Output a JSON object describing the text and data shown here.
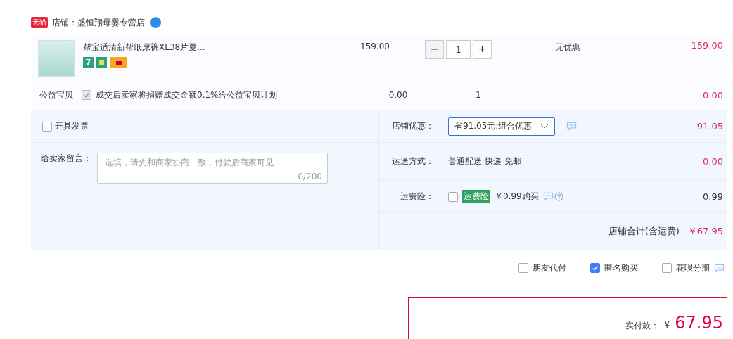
{
  "store": {
    "badge": "天猫",
    "label": "店铺：盛恒翔母婴专营店"
  },
  "item": {
    "title": "帮宝适清新帮纸尿裤XL38片夏...",
    "return_badge": "7",
    "price": "159.00",
    "minus": "−",
    "minus_disabled": true,
    "quantity": "1",
    "plus": "+",
    "discount": "无优惠",
    "subtotal": "159.00"
  },
  "charity": {
    "label": "公益宝贝",
    "checked": true,
    "disabled": true,
    "text": "成交后卖家将捐赠成交金额0.1%给公益宝贝计划",
    "price": "0.00",
    "quantity": "1",
    "subtotal": "0.00"
  },
  "invoice": {
    "label": "开具发票",
    "checked": false
  },
  "message": {
    "label": "给卖家留言：",
    "placeholder": "选填，请先和商家协商一致，付款后商家可见",
    "counter": "0/200"
  },
  "store_discount": {
    "label": "店铺优惠：",
    "value": "省91.05元:组合优惠",
    "amount": "-91.05"
  },
  "shipping": {
    "label": "运送方式：",
    "value": "普通配送 快递 免邮",
    "amount": "0.00"
  },
  "insurance": {
    "label": "运费险：",
    "checked": false,
    "tag": "运费险",
    "price": "￥0.99购买",
    "amount": "0.99"
  },
  "store_total": {
    "label": "店铺合计(含运费)",
    "amount": "￥67.95"
  },
  "options": [
    {
      "label": "朋友代付",
      "checked": false
    },
    {
      "label": "匿名购买",
      "checked": true
    },
    {
      "label": "花呗分期",
      "checked": false
    }
  ],
  "payment": {
    "label": "实付款：",
    "currency": "￥",
    "amount": "67.95"
  }
}
